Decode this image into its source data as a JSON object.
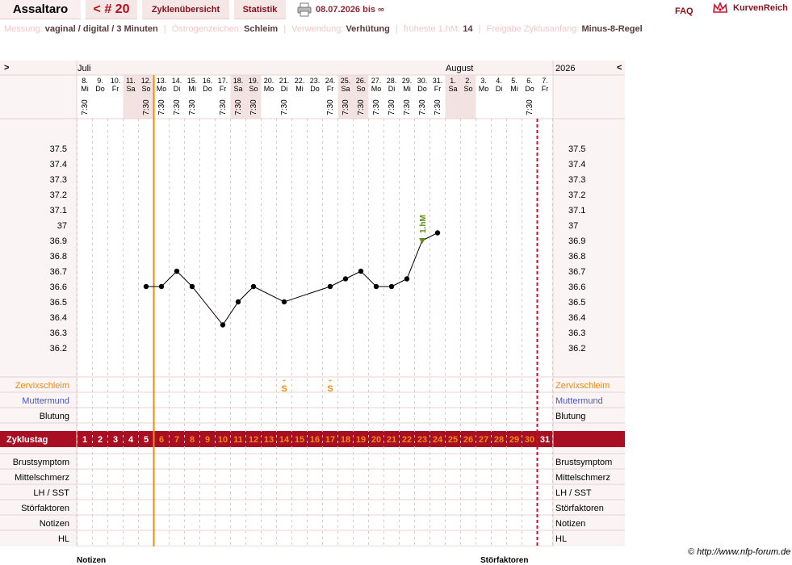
{
  "header": {
    "brand": "Assaltaro",
    "cycle": "< # 20",
    "tab_overview": "Zyklenübersicht",
    "tab_stats": "Statistik",
    "date_range": "08.07.2026 bis ∞",
    "faq": "FAQ",
    "logo_text": "KurvenReich"
  },
  "info": {
    "messung_k": "Messung:",
    "messung_v": "vaginal / digital / 3 Minuten",
    "oestro_k": "Östrogenzeichen:",
    "oestro_v": "Schleim",
    "verw_k": "Verwendung:",
    "verw_v": "Verhütung",
    "hm_k": "früheste 1.hM:",
    "hm_v": "14",
    "freigabe_k": "Freigabe Zyklusanfang:",
    "freigabe_v": "Minus-8-Regel"
  },
  "chart_data": {
    "type": "line",
    "nav_left": ">",
    "nav_right": "<",
    "month_july": "Juli",
    "month_august": "August",
    "year": "2026",
    "dates": [
      "8.",
      "9.",
      "10.",
      "11.",
      "12.",
      "13.",
      "14.",
      "15.",
      "16.",
      "17.",
      "18.",
      "19.",
      "20.",
      "21.",
      "22.",
      "23.",
      "24.",
      "25.",
      "26.",
      "27.",
      "28.",
      "29.",
      "30.",
      "31.",
      "1.",
      "2.",
      "3.",
      "4.",
      "5.",
      "6.",
      "7."
    ],
    "weekdays": [
      "Mi",
      "Do",
      "Fr",
      "Sa",
      "So",
      "Mo",
      "Di",
      "Mi",
      "Do",
      "Fr",
      "Sa",
      "So",
      "Mo",
      "Di",
      "Mi",
      "Do",
      "Fr",
      "Sa",
      "So",
      "Mo",
      "Di",
      "Mi",
      "Do",
      "Fr",
      "Sa",
      "So",
      "Mo",
      "Di",
      "Mi",
      "Do",
      "Fr"
    ],
    "weekend": [
      false,
      false,
      false,
      true,
      true,
      false,
      false,
      false,
      false,
      false,
      true,
      true,
      false,
      false,
      false,
      false,
      false,
      true,
      true,
      false,
      false,
      false,
      false,
      false,
      true,
      true,
      false,
      false,
      false,
      false,
      false
    ],
    "times": [
      "7:30",
      "",
      "",
      "",
      "7:30",
      "7:30",
      "7:30",
      "7:30",
      "",
      "7:30",
      "7:30",
      "7:30",
      "",
      "7:30",
      "",
      "",
      "7:30",
      "7:30",
      "7:30",
      "7:30",
      "7:30",
      "7:30",
      "7:30",
      "7:30",
      "",
      "",
      "",
      "",
      "",
      "7:30",
      ""
    ],
    "yticks": [
      "37.5",
      "37.4",
      "37.3",
      "37.2",
      "37.1",
      "37",
      "36.9",
      "36.8",
      "36.7",
      "36.6",
      "36.5",
      "36.4",
      "36.3",
      "36.2"
    ],
    "ylim": [
      36.2,
      37.5
    ],
    "temps": [
      null,
      null,
      null,
      null,
      36.6,
      36.6,
      36.7,
      36.6,
      null,
      36.35,
      36.5,
      36.6,
      null,
      36.5,
      null,
      null,
      36.6,
      36.65,
      36.7,
      36.6,
      36.6,
      36.65,
      36.9,
      36.95,
      null,
      null,
      null,
      null,
      null,
      null,
      null
    ],
    "hm_label": "1.hM",
    "hm_day_index": 22,
    "mucus_marks": [
      {
        "day_index": 13,
        "label": "S",
        "sup": "+"
      },
      {
        "day_index": 16,
        "label": "S",
        "sup": "+"
      }
    ],
    "labels": {
      "cervical_mucus": "Zervixschleim",
      "cervix": "Muttermund",
      "bleeding": "Blutung",
      "cycle_day": "Zyklustag",
      "breast": "Brustsymptom",
      "midpain": "Mittelschmerz",
      "lh": "LH / SST",
      "disturb": "Störfaktoren",
      "notes": "Notizen",
      "hl": "HL"
    },
    "cycle_days": [
      "1",
      "2",
      "3",
      "4",
      "5",
      "6",
      "7",
      "8",
      "9",
      "10",
      "11",
      "12",
      "13",
      "14",
      "15",
      "16",
      "17",
      "18",
      "19",
      "20",
      "21",
      "22",
      "23",
      "24",
      "25",
      "26",
      "27",
      "28",
      "29",
      "30",
      "31"
    ],
    "colors": {
      "line": "#000000",
      "orange": "#f08a10",
      "red": "#c8102e",
      "band": "#a80f22",
      "hm": "#5a8f1a",
      "weekend": "#f3e2e2"
    }
  },
  "footer": {
    "copyright": "© http://www.nfp-forum.de",
    "notes_heading": "Notizen",
    "disturb_heading": "Störfaktoren"
  }
}
